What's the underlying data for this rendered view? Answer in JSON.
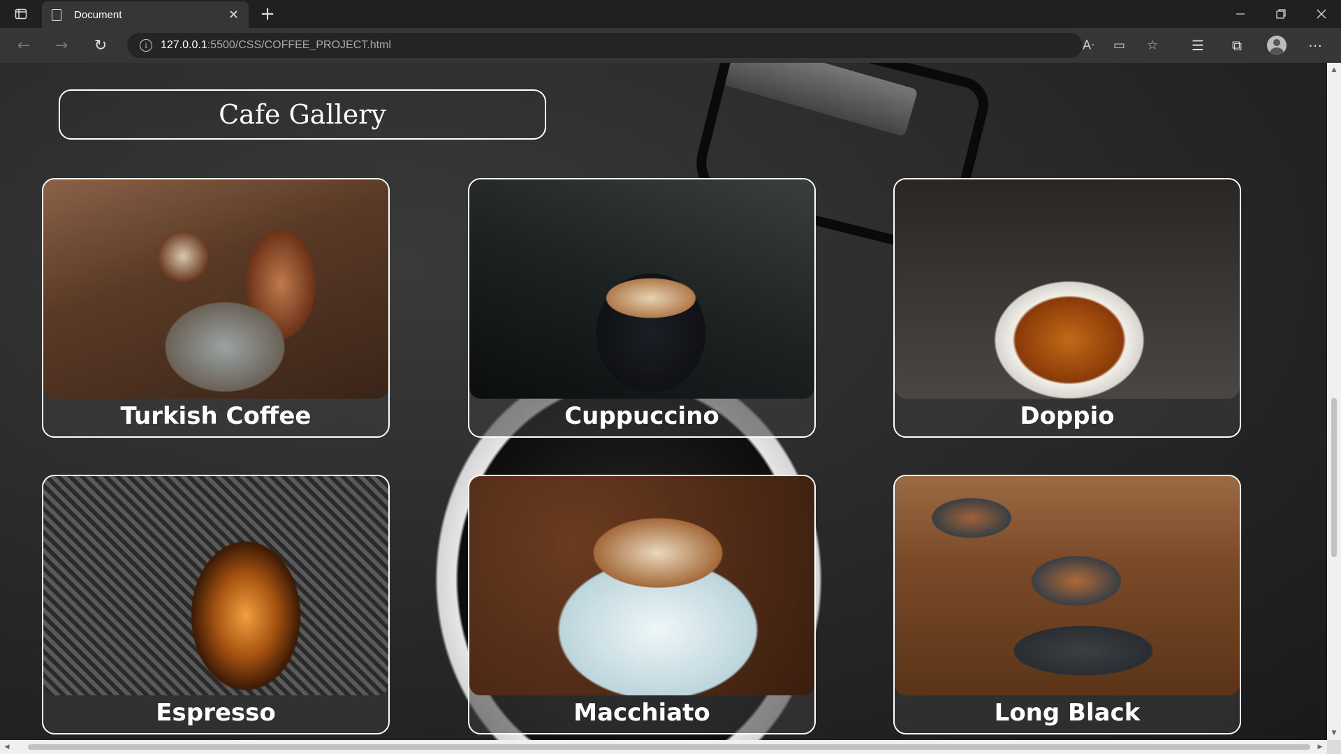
{
  "browser": {
    "tab_title": "Document",
    "new_tab_glyph": "+",
    "address": {
      "host": "127.0.0.1",
      "path": ":5500/CSS/COFFEE_PROJECT.html"
    }
  },
  "page": {
    "heading": "Cafe Gallery",
    "gallery": [
      {
        "label": "Turkish Coffee",
        "photo": "turkish"
      },
      {
        "label": "Cuppuccino",
        "photo": "cappuccino"
      },
      {
        "label": "Doppio",
        "photo": "doppio"
      },
      {
        "label": "Espresso",
        "photo": "espresso"
      },
      {
        "label": "Macchiato",
        "photo": "macchiato"
      },
      {
        "label": "Long Black",
        "photo": "longblack"
      }
    ]
  },
  "icons": {
    "tab_actions": "tab-actions-icon",
    "page": "document-icon",
    "close": "close-icon",
    "back": "back-arrow-icon",
    "forward": "forward-arrow-icon",
    "refresh": "refresh-icon",
    "info": "info-icon",
    "read_aloud": "read-aloud-icon",
    "immersive": "immersive-reader-icon",
    "add_favorite": "add-favorite-icon",
    "favorites": "favorites-icon",
    "collections": "collections-icon",
    "profile": "profile-icon",
    "more": "more-icon"
  },
  "colors": {
    "chrome_dark": "#202020",
    "toolbar": "#363636",
    "card_border": "#ffffff",
    "text": "#ffffff"
  }
}
